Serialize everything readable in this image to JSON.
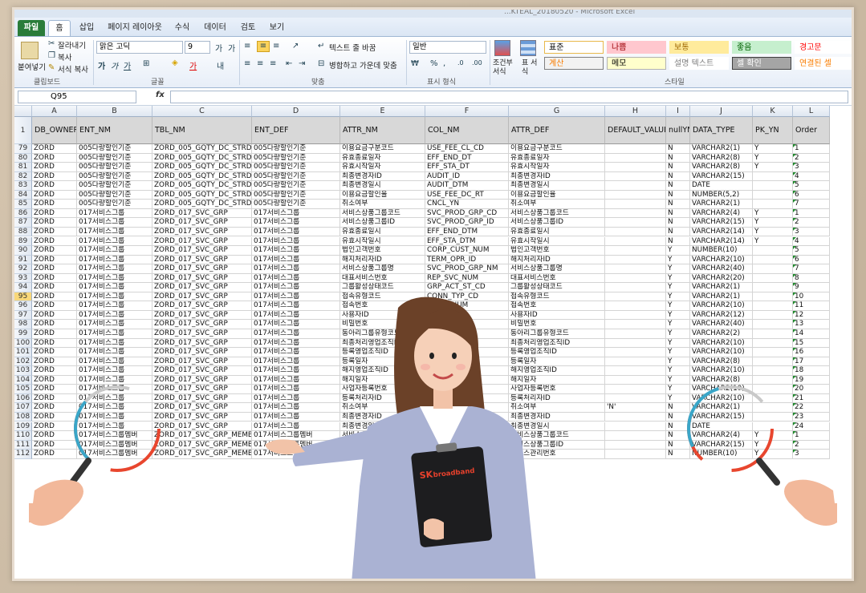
{
  "window": {
    "title": "...KTEAL_20180520 - Microsoft Excel"
  },
  "tabs": [
    {
      "label": "파일",
      "kind": "file"
    },
    {
      "label": "홈",
      "kind": "active"
    },
    {
      "label": "삽입",
      "kind": ""
    },
    {
      "label": "페이지 레이아웃",
      "kind": ""
    },
    {
      "label": "수식",
      "kind": ""
    },
    {
      "label": "데이터",
      "kind": ""
    },
    {
      "label": "검토",
      "kind": ""
    },
    {
      "label": "보기",
      "kind": ""
    }
  ],
  "ribbon": {
    "paste": "붙여넣기",
    "cut": "잘라내기",
    "copy": "복사",
    "format_painter": "서식 복사",
    "clipboard_group": "클립보드",
    "font_name": "맑은 고딕",
    "font_size": "9",
    "font_group": "글꼴",
    "wrap_text": "텍스트 줄 바꿈",
    "merge_center": "병합하고 가운데 맞춤",
    "align_group": "맞춤",
    "number_format": "일반",
    "number_group": "표시 형식",
    "cond_format": "조건부 서식",
    "table_format": "표 서식",
    "styles_group": "스타일",
    "styles": [
      {
        "label": "표준",
        "bg": "#ffffff",
        "fg": "#000000",
        "border": "#e8b84b"
      },
      {
        "label": "나쁨",
        "bg": "#ffc7ce",
        "fg": "#9c0006",
        "border": "#ffc7ce"
      },
      {
        "label": "보통",
        "bg": "#ffeb9c",
        "fg": "#9c6500",
        "border": "#ffeb9c"
      },
      {
        "label": "좋음",
        "bg": "#c6efce",
        "fg": "#006100",
        "border": "#c6efce"
      },
      {
        "label": "경고문",
        "bg": "#ffffff",
        "fg": "#ff0000",
        "border": "#ffffff"
      },
      {
        "label": "계산",
        "bg": "#f2f2f2",
        "fg": "#fa7d00",
        "border": "#7f7f7f"
      },
      {
        "label": "메모",
        "bg": "#ffffcc",
        "fg": "#000000",
        "border": "#b2b2b2"
      },
      {
        "label": "설명 텍스트",
        "bg": "#ffffff",
        "fg": "#7f7f7f",
        "border": "#ffffff"
      },
      {
        "label": "셀 확인",
        "bg": "#a5a5a5",
        "fg": "#ffffff",
        "border": "#3f3f3f"
      },
      {
        "label": "연결된 셀",
        "bg": "#ffffff",
        "fg": "#fa7d00",
        "border": "#ffffff"
      }
    ]
  },
  "formula_bar": {
    "name_box": "Q95",
    "fx": "fx",
    "value": ""
  },
  "columns": [
    "A",
    "B",
    "C",
    "D",
    "E",
    "F",
    "G",
    "H",
    "I",
    "J",
    "K",
    "L"
  ],
  "header_row": {
    "row_number": "1",
    "cells": [
      "DB_OWNER",
      "ENT_NM",
      "TBL_NM",
      "ENT_DEF",
      "ATTR_NM",
      "COL_NM",
      "ATTR_DEF",
      "DEFAULT_VALUE",
      "nullYN",
      "DATA_TYPE",
      "PK_YN",
      "Order"
    ]
  },
  "selected_row": "95",
  "rows": [
    {
      "n": "79",
      "c": [
        "ZORD",
        "005다량할인기준",
        "ZORD_005_GQTY_DC_STRD",
        "005다량할인기준",
        "이용요금구분코드",
        "USE_FEE_CL_CD",
        "이용요금구분코드",
        "",
        "N",
        "VARCHAR2(1)",
        "Y",
        "1"
      ]
    },
    {
      "n": "80",
      "c": [
        "ZORD",
        "005다량할인기준",
        "ZORD_005_GQTY_DC_STRD",
        "005다량할인기준",
        "유효종료일자",
        "EFF_END_DT",
        "유효종료일자",
        "",
        "N",
        "VARCHAR2(8)",
        "Y",
        "2"
      ]
    },
    {
      "n": "81",
      "c": [
        "ZORD",
        "005다량할인기준",
        "ZORD_005_GQTY_DC_STRD",
        "005다량할인기준",
        "유효시작일자",
        "EFF_STA_DT",
        "유효시작일자",
        "",
        "N",
        "VARCHAR2(8)",
        "Y",
        "3"
      ]
    },
    {
      "n": "82",
      "c": [
        "ZORD",
        "005다량할인기준",
        "ZORD_005_GQTY_DC_STRD",
        "005다량할인기준",
        "최종변경자ID",
        "AUDIT_ID",
        "최종변경자ID",
        "",
        "N",
        "VARCHAR2(15)",
        "",
        "4"
      ]
    },
    {
      "n": "83",
      "c": [
        "ZORD",
        "005다량할인기준",
        "ZORD_005_GQTY_DC_STRD",
        "005다량할인기준",
        "최종변경일시",
        "AUDIT_DTM",
        "최종변경일시",
        "",
        "N",
        "DATE",
        "",
        "5"
      ]
    },
    {
      "n": "84",
      "c": [
        "ZORD",
        "005다량할인기준",
        "ZORD_005_GQTY_DC_STRD",
        "005다량할인기준",
        "이용요금할인율",
        "USE_FEE_DC_RT",
        "이용요금할인율",
        "",
        "N",
        "NUMBER(5,2)",
        "",
        "6"
      ]
    },
    {
      "n": "85",
      "c": [
        "ZORD",
        "005다량할인기준",
        "ZORD_005_GQTY_DC_STRD",
        "005다량할인기준",
        "취소여부",
        "CNCL_YN",
        "취소여부",
        "",
        "N",
        "VARCHAR2(1)",
        "",
        "7"
      ]
    },
    {
      "n": "86",
      "c": [
        "ZORD",
        "017서비스그룹",
        "ZORD_017_SVC_GRP",
        "017서비스그룹",
        "서비스상품그룹코드",
        "SVC_PROD_GRP_CD",
        "서비스상품그룹코드",
        "",
        "N",
        "VARCHAR2(4)",
        "Y",
        "1"
      ]
    },
    {
      "n": "87",
      "c": [
        "ZORD",
        "017서비스그룹",
        "ZORD_017_SVC_GRP",
        "017서비스그룹",
        "서비스상품그룹ID",
        "SVC_PROD_GRP_ID",
        "서비스상품그룹ID",
        "",
        "N",
        "VARCHAR2(15)",
        "Y",
        "2"
      ]
    },
    {
      "n": "88",
      "c": [
        "ZORD",
        "017서비스그룹",
        "ZORD_017_SVC_GRP",
        "017서비스그룹",
        "유효종료일시",
        "EFF_END_DTM",
        "유효종료일시",
        "",
        "N",
        "VARCHAR2(14)",
        "Y",
        "3"
      ]
    },
    {
      "n": "89",
      "c": [
        "ZORD",
        "017서비스그룹",
        "ZORD_017_SVC_GRP",
        "017서비스그룹",
        "유효시작일시",
        "EFF_STA_DTM",
        "유효시작일시",
        "",
        "N",
        "VARCHAR2(14)",
        "Y",
        "4"
      ]
    },
    {
      "n": "90",
      "c": [
        "ZORD",
        "017서비스그룹",
        "ZORD_017_SVC_GRP",
        "017서비스그룹",
        "법인고객번호",
        "CORP_CUST_NUM",
        "법인고객번호",
        "",
        "Y",
        "NUMBER(10)",
        "",
        "5"
      ]
    },
    {
      "n": "91",
      "c": [
        "ZORD",
        "017서비스그룹",
        "ZORD_017_SVC_GRP",
        "017서비스그룹",
        "해지처리자ID",
        "TERM_OPR_ID",
        "해지처리자ID",
        "",
        "Y",
        "VARCHAR2(10)",
        "",
        "6"
      ]
    },
    {
      "n": "92",
      "c": [
        "ZORD",
        "017서비스그룹",
        "ZORD_017_SVC_GRP",
        "017서비스그룹",
        "서비스상품그룹명",
        "SVC_PROD_GRP_NM",
        "서비스상품그룹명",
        "",
        "Y",
        "VARCHAR2(40)",
        "",
        "7"
      ]
    },
    {
      "n": "93",
      "c": [
        "ZORD",
        "017서비스그룹",
        "ZORD_017_SVC_GRP",
        "017서비스그룹",
        "대표서비스번호",
        "REP_SVC_NUM",
        "대표서비스번호",
        "",
        "Y",
        "VARCHAR2(20)",
        "",
        "8"
      ]
    },
    {
      "n": "94",
      "c": [
        "ZORD",
        "017서비스그룹",
        "ZORD_017_SVC_GRP",
        "017서비스그룹",
        "그룹활성상태코드",
        "GRP_ACT_ST_CD",
        "그룹활성상태코드",
        "",
        "Y",
        "VARCHAR2(1)",
        "",
        "9"
      ]
    },
    {
      "n": "95",
      "c": [
        "ZORD",
        "017서비스그룹",
        "ZORD_017_SVC_GRP",
        "017서비스그룹",
        "접속유형코드",
        "CONN_TYP_CD",
        "접속유형코드",
        "",
        "Y",
        "VARCHAR2(1)",
        "",
        "10"
      ]
    },
    {
      "n": "96",
      "c": [
        "ZORD",
        "017서비스그룹",
        "ZORD_017_SVC_GRP",
        "017서비스그룹",
        "접속번호",
        "CONN_NUM",
        "접속번호",
        "",
        "Y",
        "VARCHAR2(10)",
        "",
        "11"
      ]
    },
    {
      "n": "97",
      "c": [
        "ZORD",
        "017서비스그룹",
        "ZORD_017_SVC_GRP",
        "017서비스그룹",
        "사용자ID",
        "USER_ID",
        "사용자ID",
        "",
        "Y",
        "VARCHAR2(12)",
        "",
        "12"
      ]
    },
    {
      "n": "98",
      "c": [
        "ZORD",
        "017서비스그룹",
        "ZORD_017_SVC_GRP",
        "017서비스그룹",
        "비밀번호",
        "",
        "비밀번호",
        "",
        "Y",
        "VARCHAR2(40)",
        "",
        "13"
      ]
    },
    {
      "n": "99",
      "c": [
        "ZORD",
        "017서비스그룹",
        "ZORD_017_SVC_GRP",
        "017서비스그룹",
        "동아리그룹유형코드",
        "",
        "동아리그룹유형코드",
        "",
        "Y",
        "VARCHAR2(2)",
        "",
        "14"
      ]
    },
    {
      "n": "100",
      "c": [
        "ZORD",
        "017서비스그룹",
        "ZORD_017_SVC_GRP",
        "017서비스그룹",
        "최종처리영업조직ID",
        "",
        "최종처리영업조직ID",
        "",
        "Y",
        "VARCHAR2(10)",
        "",
        "15"
      ]
    },
    {
      "n": "101",
      "c": [
        "ZORD",
        "017서비스그룹",
        "ZORD_017_SVC_GRP",
        "017서비스그룹",
        "등록영업조직ID",
        "",
        "등록영업조직ID",
        "",
        "Y",
        "VARCHAR2(10)",
        "",
        "16"
      ]
    },
    {
      "n": "102",
      "c": [
        "ZORD",
        "017서비스그룹",
        "ZORD_017_SVC_GRP",
        "017서비스그룹",
        "등록일자",
        "",
        "등록일자",
        "",
        "Y",
        "VARCHAR2(8)",
        "",
        "17"
      ]
    },
    {
      "n": "103",
      "c": [
        "ZORD",
        "017서비스그룹",
        "ZORD_017_SVC_GRP",
        "017서비스그룹",
        "해지영업조직ID",
        "",
        "해지영업조직ID",
        "",
        "Y",
        "VARCHAR2(10)",
        "",
        "18"
      ]
    },
    {
      "n": "104",
      "c": [
        "ZORD",
        "017서비스그룹",
        "ZORD_017_SVC_GRP",
        "017서비스그룹",
        "해지일자",
        "",
        "해지일자",
        "",
        "Y",
        "VARCHAR2(8)",
        "",
        "19"
      ]
    },
    {
      "n": "105",
      "c": [
        "ZORD",
        "017서비스그룹",
        "ZORD_017_SVC_GRP",
        "017서비스그룹",
        "사업자등록번호",
        "",
        "사업자등록번호",
        "",
        "Y",
        "VARCHAR2(10)",
        "",
        "20"
      ]
    },
    {
      "n": "106",
      "c": [
        "ZORD",
        "017서비스그룹",
        "ZORD_017_SVC_GRP",
        "017서비스그룹",
        "등록처리자ID",
        "",
        "등록처리자ID",
        "",
        "Y",
        "VARCHAR2(10)",
        "",
        "21"
      ]
    },
    {
      "n": "107",
      "c": [
        "ZORD",
        "017서비스그룹",
        "ZORD_017_SVC_GRP",
        "017서비스그룹",
        "취소여부",
        "",
        "취소여부",
        "'N'",
        "N",
        "VARCHAR2(1)",
        "",
        "22"
      ]
    },
    {
      "n": "108",
      "c": [
        "ZORD",
        "017서비스그룹",
        "ZORD_017_SVC_GRP",
        "017서비스그룹",
        "최종변경자ID",
        "",
        "최종변경자ID",
        "",
        "N",
        "VARCHAR2(15)",
        "",
        "23"
      ]
    },
    {
      "n": "109",
      "c": [
        "ZORD",
        "017서비스그룹",
        "ZORD_017_SVC_GRP",
        "017서비스그룹",
        "최종변경일시",
        "",
        "최종변경일시",
        "",
        "N",
        "DATE",
        "",
        "24"
      ]
    },
    {
      "n": "110",
      "c": [
        "ZORD",
        "017서비스그룹멤버",
        "ZORD_017_SVC_GRP_MEMB",
        "017서비스그룹멤버",
        "서비스상품그룹코드",
        "",
        "서비스상품그룹코드",
        "",
        "N",
        "VARCHAR2(4)",
        "Y",
        "1"
      ]
    },
    {
      "n": "111",
      "c": [
        "ZORD",
        "017서비스그룹멤버",
        "ZORD_017_SVC_GRP_MEMB",
        "017서비스그룹멤버",
        "서비스상품그룹ID",
        "",
        "서비스상품그룹ID",
        "",
        "N",
        "VARCHAR2(15)",
        "Y",
        "2"
      ]
    },
    {
      "n": "112",
      "c": [
        "ZORD",
        "017서비스그룹멤버",
        "ZORD_017_SVC_GRP_MEMB",
        "017서비스그룹멤버",
        "서비스관리번호",
        "",
        "서비스관리번호",
        "",
        "N",
        "NUMBER(10)",
        "Y",
        "3"
      ]
    }
  ],
  "clipboard_brand": {
    "prefix": "SK",
    "suffix": "broadband",
    "color": "#e8412c"
  },
  "icons": [
    "cut-icon",
    "copy-icon",
    "format-painter-icon",
    "bold-icon",
    "italic-icon",
    "underline-icon",
    "fx-icon",
    "magnifier-icon"
  ]
}
